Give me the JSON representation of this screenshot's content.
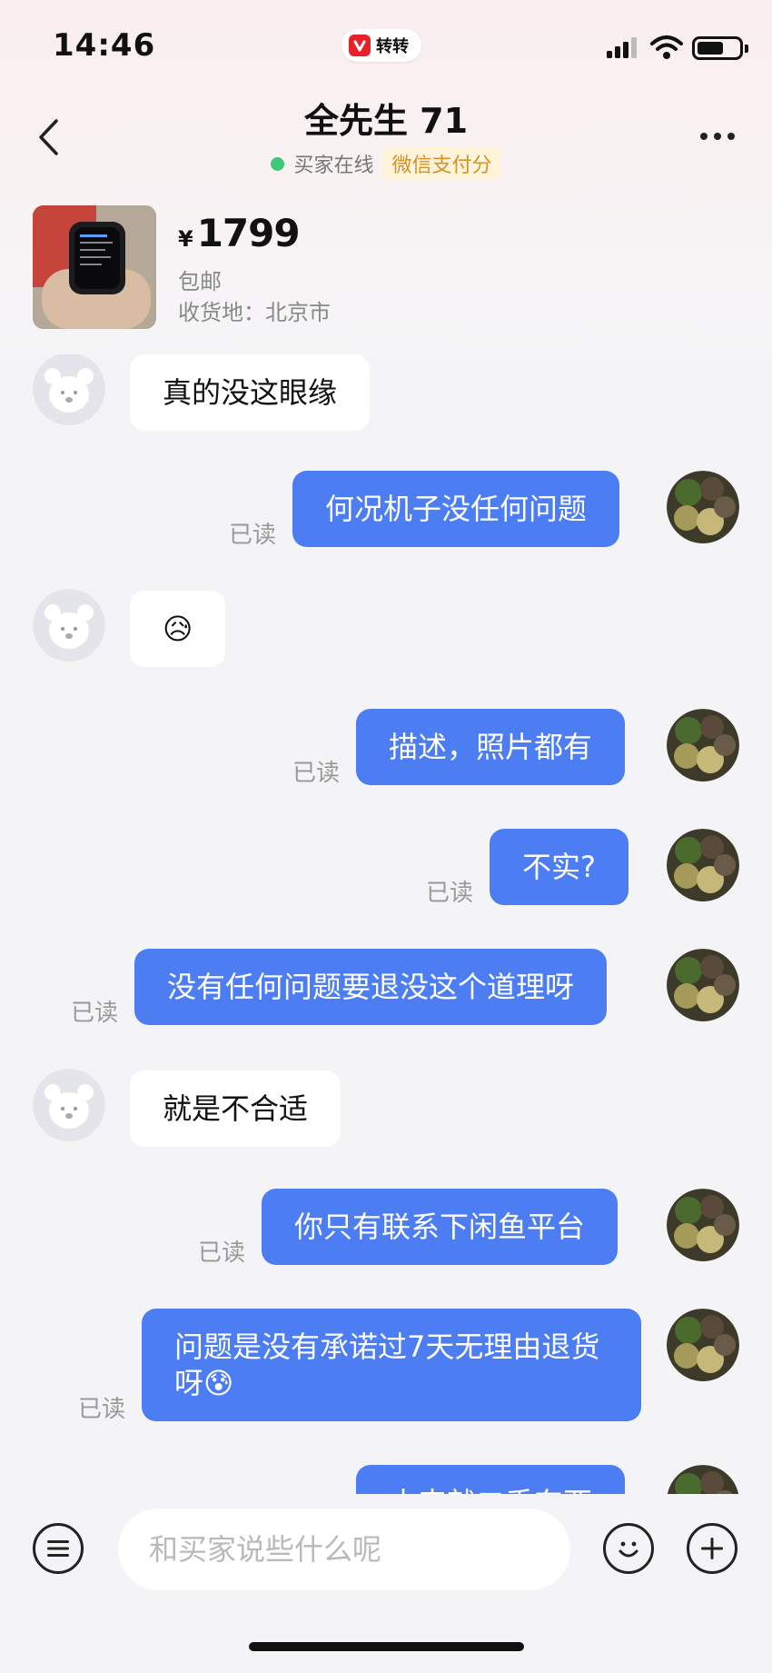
{
  "status_bar": {
    "time": "14:46",
    "app_name": "转转"
  },
  "header": {
    "title": "全先生 71",
    "online_text": "买家在线",
    "pay_badge": "微信支付分"
  },
  "product": {
    "currency": "¥",
    "price": "1799",
    "shipping": "包邮",
    "address": "收货地：北京市"
  },
  "messages": [
    {
      "side": "in",
      "text": "真的没这眼缘"
    },
    {
      "side": "out",
      "text": "何况机子没任何问题",
      "status": "已读"
    },
    {
      "side": "in",
      "text": "😥"
    },
    {
      "side": "out",
      "text": "描述，照片都有",
      "status": "已读"
    },
    {
      "side": "out",
      "text": "不实?",
      "status": "已读"
    },
    {
      "side": "out",
      "text": "没有任何问题要退没这个道理呀",
      "status": "已读"
    },
    {
      "side": "in",
      "text": "就是不合适"
    },
    {
      "side": "out",
      "text": "你只有联系下闲鱼平台",
      "status": "已读"
    },
    {
      "side": "out",
      "text": "问题是没有承诺过7天无理由退货呀😰",
      "status": "已读"
    },
    {
      "side": "out",
      "text": "本来就二手东西"
    }
  ],
  "input": {
    "placeholder": "和买家说些什么呢"
  },
  "icons": {
    "back": "chevron-left-icon",
    "more": "more-dots-icon",
    "menu": "menu-icon",
    "emoji": "emoji-icon",
    "plus": "plus-icon"
  },
  "colors": {
    "bubble_out": "#4c7df2",
    "bubble_in": "#ffffff",
    "online": "#3cc97a",
    "pay_badge": "#d2922a"
  }
}
